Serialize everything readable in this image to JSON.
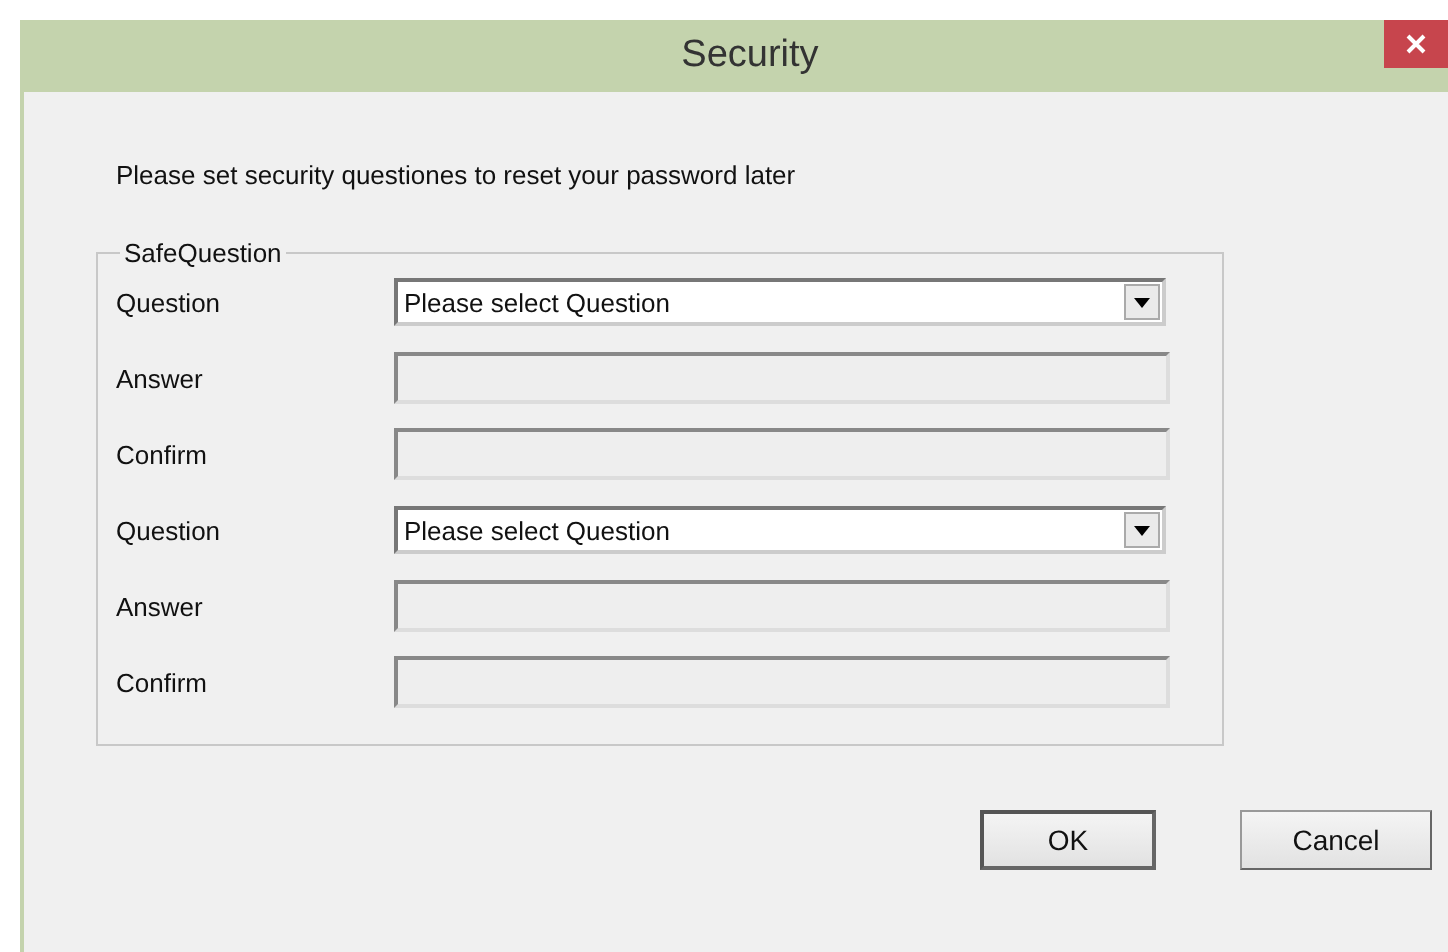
{
  "window": {
    "title": "Security"
  },
  "message": "Please set security questiones to reset your password later",
  "group": {
    "title": "SafeQuestion",
    "rows": [
      {
        "kind": "select",
        "label": "Question",
        "value": "Please select Question"
      },
      {
        "kind": "text",
        "label": "Answer",
        "disabled": true
      },
      {
        "kind": "text",
        "label": "Confirm",
        "disabled": true
      },
      {
        "kind": "select",
        "label": "Question",
        "value": "Please select Question"
      },
      {
        "kind": "text",
        "label": "Answer",
        "disabled": true
      },
      {
        "kind": "text",
        "label": "Confirm",
        "disabled": true
      }
    ]
  },
  "buttons": [
    {
      "label": "OK",
      "default": true
    },
    {
      "label": "Cancel",
      "default": false
    }
  ]
}
